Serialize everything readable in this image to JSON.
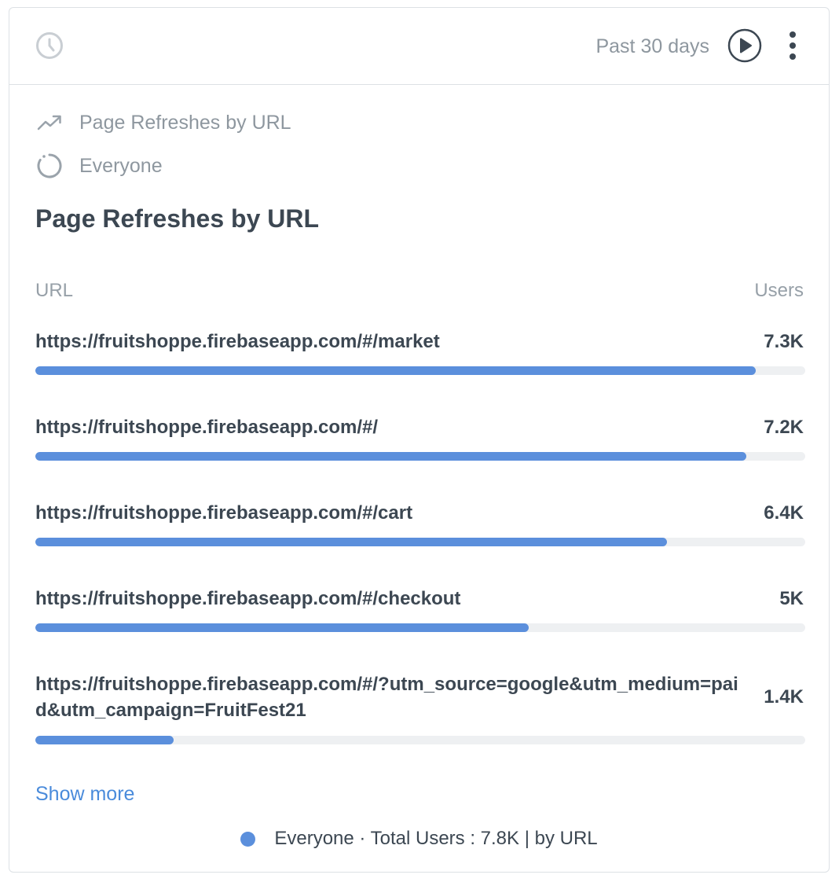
{
  "header": {
    "range_label": "Past 30 days",
    "icons": {
      "history": "clock-icon",
      "run": "play-icon",
      "menu": "more-vertical-icon"
    }
  },
  "meta": {
    "metric_label": "Page Refreshes by URL",
    "segment_label": "Everyone"
  },
  "title": "Page Refreshes by URL",
  "columns": {
    "left": "URL",
    "right": "Users"
  },
  "chart_data": {
    "type": "bar",
    "orientation": "horizontal",
    "xlabel": "Users",
    "ylabel": "URL",
    "categories": [
      "https://fruitshoppe.firebaseapp.com/#/market",
      "https://fruitshoppe.firebaseapp.com/#/",
      "https://fruitshoppe.firebaseapp.com/#/cart",
      "https://fruitshoppe.firebaseapp.com/#/checkout",
      "https://fruitshoppe.firebaseapp.com/#/?utm_source=google&utm_medium=paid&utm_campaign=FruitFest21"
    ],
    "values": [
      7300,
      7200,
      6400,
      5000,
      1400
    ],
    "value_labels": [
      "7.3K",
      "7.2K",
      "6.4K",
      "5K",
      "1.4K"
    ],
    "series": [
      {
        "name": "Everyone",
        "color": "#5b8fdc"
      }
    ]
  },
  "show_more_label": "Show more",
  "legend": {
    "color": "#5b8fdc",
    "text": "Everyone · Total Users : 7.8K | by URL"
  }
}
